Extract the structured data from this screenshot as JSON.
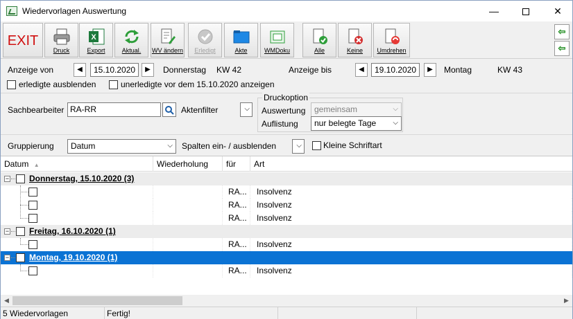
{
  "window": {
    "title": "Wiedervorlagen Auswertung",
    "minimize": "—",
    "close": "✕"
  },
  "toolbar": {
    "exit": "EXIT",
    "buttons": [
      {
        "label": "Druck",
        "icon": "printer-icon"
      },
      {
        "label": "Export",
        "icon": "excel-icon"
      },
      {
        "label": "Aktual.",
        "icon": "refresh-icon"
      },
      {
        "label": "WV ändern",
        "icon": "edit-document-icon"
      },
      {
        "label": "Erledigt",
        "icon": "check-icon",
        "disabled": true
      },
      {
        "label": "Akte",
        "icon": "folder-icon"
      },
      {
        "label": "WMDoku",
        "icon": "green-folder-icon"
      },
      {
        "label": "Alle",
        "icon": "check-all-icon"
      },
      {
        "label": "Keine",
        "icon": "uncheck-all-icon"
      },
      {
        "label": "Umdrehen",
        "icon": "invert-selection-icon"
      }
    ],
    "side_buttons": [
      "arrow-left-icon",
      "arrow-left-bottom-icon"
    ]
  },
  "filter": {
    "anzeige_von_label": "Anzeige von",
    "date_from": "15.10.2020",
    "weekday_from": "Donnerstag",
    "kw_from": "KW 42",
    "anzeige_bis_label": "Anzeige bis",
    "date_to": "19.10.2020",
    "weekday_to": "Montag",
    "kw_to": "KW 43",
    "hide_done_label": "erledigte ausblenden",
    "show_undone_label": "unerledigte vor dem 15.10.2020 anzeigen",
    "sachbearbeiter_label": "Sachbearbeiter",
    "sachbearbeiter_value": "RA-RR",
    "aktenfilter_label": "Aktenfilter",
    "druckoption_label": "Druckoption",
    "auswertung_label": "Auswertung",
    "auswertung_value": "gemeinsam",
    "auflistung_label": "Auflistung",
    "auflistung_value": "nur belegte Tage",
    "gruppierung_label": "Gruppierung",
    "gruppierung_value": "Datum",
    "spalten_label": "Spalten ein- / ausblenden",
    "kleine_schrift_label": "Kleine Schriftart"
  },
  "grid": {
    "columns": [
      "Datum",
      "Wiederholung",
      "für",
      "Art"
    ],
    "sort_indicator": "▲",
    "groups": [
      {
        "title": "Donnerstag, 15.10.2020 (3)",
        "selected": false,
        "rows": [
          {
            "wiederholung": "",
            "fuer": "RA...",
            "art": "Insolvenz"
          },
          {
            "wiederholung": "",
            "fuer": "RA...",
            "art": "Insolvenz"
          },
          {
            "wiederholung": "",
            "fuer": "RA...",
            "art": "Insolvenz"
          }
        ]
      },
      {
        "title": "Freitag, 16.10.2020 (1)",
        "selected": false,
        "rows": [
          {
            "wiederholung": "",
            "fuer": "RA...",
            "art": "Insolvenz"
          }
        ]
      },
      {
        "title": "Montag, 19.10.2020 (1)",
        "selected": true,
        "rows": [
          {
            "wiederholung": "",
            "fuer": "RA...",
            "art": "Insolvenz"
          }
        ]
      }
    ]
  },
  "status": {
    "count": "5 Wiedervorlagen",
    "state": "Fertig!"
  }
}
